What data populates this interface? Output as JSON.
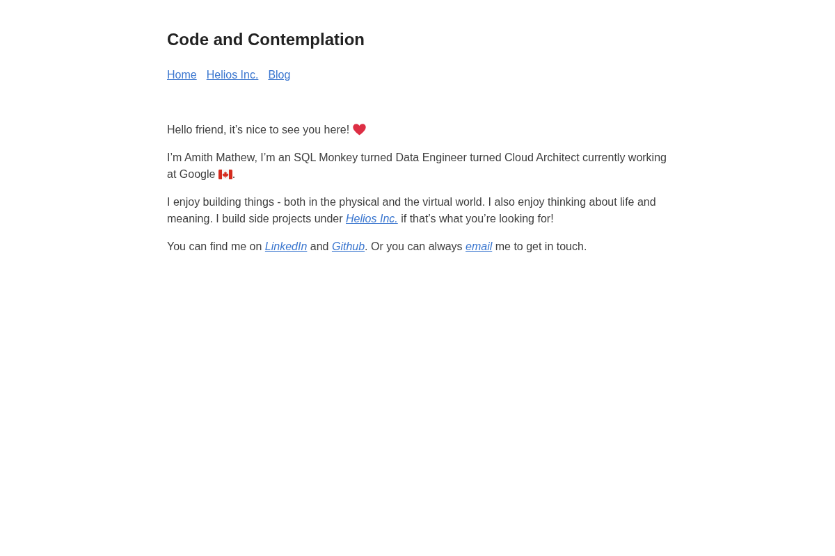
{
  "site": {
    "title": "Code and Contemplation"
  },
  "nav": [
    "Home",
    "Helios Inc.",
    "Blog"
  ],
  "paragraphs": [
    {
      "parts": [
        {
          "kind": "text",
          "text": "Hello friend, it’s nice to see you here! "
        },
        {
          "kind": "heart"
        }
      ]
    },
    {
      "parts": [
        {
          "kind": "text",
          "text": "I’m Amith Mathew, I’m an SQL Monkey turned Data Engineer turned Cloud Architect currently working at Google "
        },
        {
          "kind": "flag"
        },
        {
          "kind": "text",
          "text": "."
        }
      ]
    },
    {
      "parts": [
        {
          "kind": "text",
          "text": "I enjoy building things - both in the physical and the virtual world. I also enjoy thinking about life and meaning. I build side projects under "
        },
        {
          "kind": "link",
          "text": "Helios Inc."
        },
        {
          "kind": "text",
          "text": " if that’s what you’re looking for!"
        }
      ]
    },
    {
      "parts": [
        {
          "kind": "text",
          "text": "You can find me on "
        },
        {
          "kind": "link",
          "text": "LinkedIn"
        },
        {
          "kind": "text",
          "text": " and "
        },
        {
          "kind": "link",
          "text": "Github"
        },
        {
          "kind": "text",
          "text": ". Or you can always "
        },
        {
          "kind": "link",
          "text": "email"
        },
        {
          "kind": "text",
          "text": " me to get in touch."
        }
      ]
    }
  ]
}
